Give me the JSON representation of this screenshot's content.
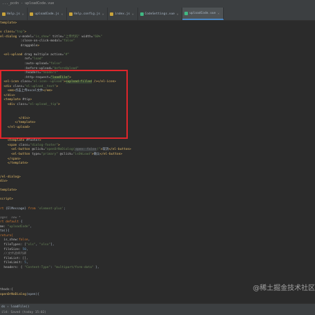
{
  "window": {
    "title": "..._pcdn - uploadCode.vue"
  },
  "tabs": [
    {
      "label": "Help.js",
      "color": "#c9a43b"
    },
    {
      "label": "uploadCode.js",
      "color": "#c9a43b"
    },
    {
      "label": "Help.config.js",
      "color": "#c9a43b"
    },
    {
      "label": "index.js",
      "color": "#c9a43b"
    },
    {
      "label": "CodeSettings.vue",
      "color": "#41b883"
    },
    {
      "label": "uploadCode.vue",
      "color": "#41b883",
      "active": true
    }
  ],
  "code": [
    [
      [
        "template>",
        "tag"
      ]
    ],
    [],
    [
      [
        "v class=",
        "tag"
      ],
      [
        "\"top\"",
        "str"
      ],
      [
        ">",
        "tag"
      ]
    ],
    [
      [
        "el-dialog ",
        "tag"
      ],
      [
        "v-model=",
        "attr"
      ],
      [
        "\"is_show\"",
        "str"
      ],
      [
        " title=",
        "attr"
      ],
      [
        "\"上传代码\"",
        "str"
      ],
      [
        " width=",
        "attr"
      ],
      [
        "\"60%\"",
        "str"
      ]
    ],
    [
      [
        "           :close-on-click-modal=",
        "attr"
      ],
      [
        "\"false\"",
        "str"
      ]
    ],
    [
      [
        "           draggable",
        "attr"
      ],
      [
        ">",
        "tag"
      ]
    ],
    [],
    [
      [
        "  <el-upload ",
        "tag"
      ],
      [
        "drag multiple action=",
        "attr"
      ],
      [
        "\"#\"",
        "str"
      ]
    ],
    [
      [
        "             ref=",
        "attr"
      ],
      [
        "\"load\"",
        "str"
      ]
    ],
    [
      [
        "             :auto-upload=",
        "attr"
      ],
      [
        "\"false\"",
        "str"
      ]
    ],
    [
      [
        "             :before-upload=",
        "attr"
      ],
      [
        "\"beforeUpload\"",
        "str"
      ]
    ],
    [
      [
        "             :headers=",
        "attr"
      ],
      [
        "\"headers\"",
        "str"
      ]
    ],
    [
      [
        "             :http-request=",
        "attr"
      ],
      [
        "\"loadFile\"",
        "hl"
      ],
      [
        ">",
        "tag"
      ]
    ],
    [
      [
        "  <el-icon ",
        "tag"
      ],
      [
        "class=",
        "attr"
      ],
      [
        "\"el-icon--upload\"",
        "str"
      ],
      [
        ">",
        "tag"
      ],
      [
        "<upload-filled",
        "hl"
      ],
      [
        " /></el-icon>",
        "tag"
      ]
    ],
    [
      [
        "  <div ",
        "tag"
      ],
      [
        "class=",
        "attr"
      ],
      [
        "\"el-upload__text\"",
        "str"
      ],
      [
        ">",
        "tag"
      ]
    ],
    [
      [
        "    <em>",
        "tag"
      ],
      [
        "点击上传excel文件",
        "plain"
      ],
      [
        "</em>",
        "tag"
      ]
    ],
    [
      [
        "  </div>",
        "tag"
      ]
    ],
    [
      [
        "  <template ",
        "tag"
      ],
      [
        "#tip",
        "attr"
      ],
      [
        ">",
        "tag"
      ]
    ],
    [
      [
        "    <div ",
        "tag"
      ],
      [
        "class=",
        "attr"
      ],
      [
        "\"el-upload__tip\"",
        "str"
      ],
      [
        ">",
        "tag"
      ]
    ],
    [],
    [],
    [
      [
        "          </div>",
        "tag"
      ]
    ],
    [
      [
        "        </template>",
        "tag"
      ]
    ],
    [
      [
        "    </el-upload>",
        "tag"
      ]
    ],
    [],
    [],
    [
      [
        "    <template ",
        "tag"
      ],
      [
        "#footer",
        "attr"
      ],
      [
        ">",
        "tag"
      ]
    ],
    [
      [
        "    <span ",
        "tag"
      ],
      [
        "class=",
        "attr"
      ],
      [
        "\"dialog-footer\"",
        "str"
      ],
      [
        ">",
        "tag"
      ]
    ],
    [
      [
        "      <el-button ",
        "tag"
      ],
      [
        "@click=",
        "attr"
      ],
      [
        "\"openOrNoDialog(",
        "str"
      ],
      [
        "open: false",
        "hint"
      ],
      [
        ")\"",
        "str"
      ],
      [
        ">",
        "tag"
      ],
      [
        "取消",
        "plain"
      ],
      [
        "</el-button>",
        "tag"
      ]
    ],
    [
      [
        "      <el-button ",
        "tag"
      ],
      [
        "type=",
        "attr"
      ],
      [
        "\"primary\"",
        "str"
      ],
      [
        " @click=",
        "attr"
      ],
      [
        "\"isOkLoad\"",
        "str"
      ],
      [
        ">",
        "tag"
      ],
      [
        "确认",
        "plain"
      ],
      [
        "</el-button>",
        "tag"
      ]
    ],
    [
      [
        "    </span>",
        "tag"
      ]
    ],
    [
      [
        "    </template>",
        "tag"
      ]
    ],
    [],
    [],
    [
      [
        "/el-dialog>",
        "tag"
      ]
    ],
    [
      [
        "div>",
        "tag"
      ]
    ],
    [],
    [
      [
        "template>",
        "tag"
      ]
    ],
    [],
    [
      [
        "script>",
        "tag"
      ]
    ],
    [],
    [
      [
        "rt ",
        "kw"
      ],
      [
        "{ElMessage} ",
        "plain"
      ],
      [
        "from ",
        "kw"
      ],
      [
        "'element-plus'",
        "str"
      ],
      [
        ";",
        "plain"
      ]
    ],
    [],
    [
      [
        "ages  new *",
        "cmt"
      ]
    ],
    [
      [
        "rt default ",
        "kw"
      ],
      [
        "{",
        "plain"
      ]
    ],
    [
      [
        "me: ",
        "attr"
      ],
      [
        "\"uploadCode\"",
        "str"
      ],
      [
        ",",
        "plain"
      ]
    ],
    [
      [
        "ta(){",
        "plain"
      ]
    ],
    [
      [
        "return{",
        "kw"
      ]
    ],
    [
      [
        "  is_show:",
        "attr"
      ],
      [
        "false",
        "kw"
      ],
      [
        ",",
        "plain"
      ]
    ],
    [
      [
        "  fileTypes: [",
        "attr"
      ],
      [
        "\"xls\"",
        "str"
      ],
      [
        ", ",
        "plain"
      ],
      [
        "\"xlsx\"",
        "str"
      ],
      [
        "],",
        "plain"
      ]
    ],
    [
      [
        "  fileSize: ",
        "attr"
      ],
      [
        "50",
        "num"
      ],
      [
        ",",
        "plain"
      ]
    ],
    [
      [
        "  //文件选择列表",
        "cmt"
      ]
    ],
    [
      [
        "  fileList: [],",
        "attr"
      ]
    ],
    [
      [
        "  fileLimit: ",
        "attr"
      ],
      [
        "5",
        "num"
      ],
      [
        ",",
        "plain"
      ]
    ],
    [
      [
        "  headers: { ",
        "attr"
      ],
      [
        "\"Content-Type\"",
        "str"
      ],
      [
        ": ",
        "plain"
      ],
      [
        "\"multipart/form-data\"",
        "str"
      ],
      [
        " },",
        "plain"
      ]
    ],
    [],
    [],
    [],
    [],
    [
      [
        "thods:{",
        "attr"
      ]
    ],
    [
      [
        "openOrNoDialog",
        "tag"
      ],
      [
        "(open){",
        "plain"
      ]
    ]
  ],
  "status": {
    "crumbs": "ds › loadFile()",
    "text": "ild: Saved (today 15:02)"
  },
  "watermark": "@稀土掘金技术社区"
}
